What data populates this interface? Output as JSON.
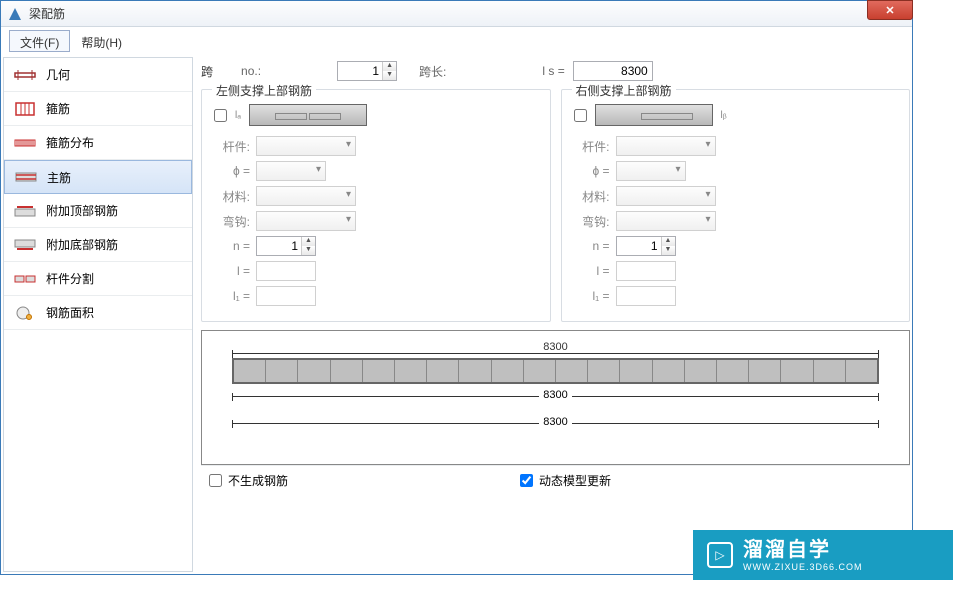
{
  "window": {
    "title": "梁配筋"
  },
  "menu": {
    "file": "文件(F)",
    "help": "帮助(H)"
  },
  "sidebar": {
    "items": [
      {
        "label": "几何"
      },
      {
        "label": "箍筋"
      },
      {
        "label": "箍筋分布"
      },
      {
        "label": "主筋"
      },
      {
        "label": "附加顶部钢筋"
      },
      {
        "label": "附加底部钢筋"
      },
      {
        "label": "杆件分割"
      },
      {
        "label": "钢筋面积"
      }
    ]
  },
  "span": {
    "kua_label": "跨",
    "no_label": "no.:",
    "no_value": "1",
    "kua_chang_label": "跨长:",
    "ls_label": "l s =",
    "ls_value": "8300"
  },
  "group_left": {
    "title": "左侧支撑上部钢筋",
    "labels": {
      "ganjian": "杆件:",
      "phi": "ϕ =",
      "cailiao": "材料:",
      "wangou": "弯钩:",
      "n": "n =",
      "l": "l =",
      "l1": "l₁ ="
    },
    "n_value": "1"
  },
  "group_right": {
    "title": "右侧支撑上部钢筋",
    "labels": {
      "ganjian": "杆件:",
      "phi": "ϕ =",
      "cailiao": "材料:",
      "wangou": "弯钩:",
      "n": "n =",
      "l": "l =",
      "l1": "l₁ ="
    },
    "n_value": "1"
  },
  "diagram": {
    "dim_top": "8300",
    "dim_mid": "8300",
    "dim_bot": "8300"
  },
  "bottom": {
    "no_gen": "不生成钢筋",
    "dynamic": "动态模型更新"
  },
  "watermark": {
    "big": "溜溜自学",
    "small": "WWW.ZIXUE.3D66.COM",
    "play": "▷"
  }
}
